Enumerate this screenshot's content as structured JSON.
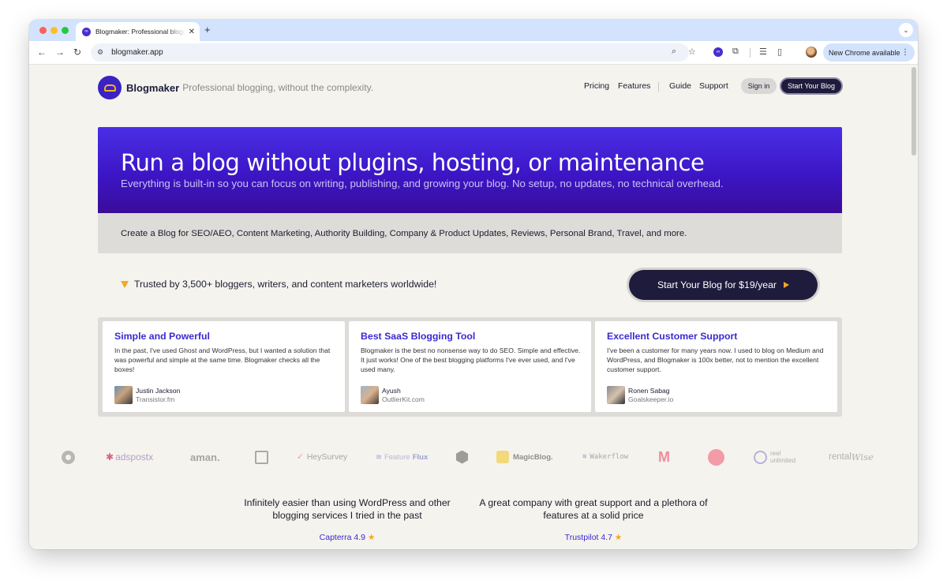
{
  "browser": {
    "tab_title": "Blogmaker: Professional blogging, without the complexity",
    "url": "blogmaker.app",
    "update_pill": "New Chrome available"
  },
  "site": {
    "brand_name": "Blogmaker",
    "tagline": "Professional blogging, without the complexity.",
    "nav": {
      "pricing": "Pricing",
      "features": "Features",
      "guide": "Guide",
      "support": "Support"
    },
    "signin": "Sign in",
    "start_small": "Start Your Blog"
  },
  "hero": {
    "title": "Run a blog without plugins, hosting, or maintenance",
    "subtitle": "Everything is built-in so you can focus on writing, publishing, and growing your blog. No setup, no updates, no technical overhead."
  },
  "usecases": "Create a Blog for SEO/AEO, Content Marketing, Authority Building, Company & Product Updates, Reviews, Personal Brand, Travel, and more.",
  "trusted": "Trusted by 3,500+ bloggers, writers, and content marketers worldwide!",
  "cta": "Start Your Blog for $19/year",
  "reviews": [
    {
      "title": "Simple and Powerful",
      "body": "In the past, I've used Ghost and WordPress, but I wanted a solution that was powerful and simple at the same time. Blogmaker checks all the boxes!",
      "name": "Justin Jackson",
      "site": "Transistor.fm"
    },
    {
      "title": "Best SaaS Blogging Tool",
      "body": "Blogmaker is the best no nonsense way to do SEO. Simple and effective. It just works! One of the best blogging platforms I've ever used, and I've used many.",
      "name": "Ayush",
      "site": "OutlierKit.com"
    },
    {
      "title": "Excellent Customer Support",
      "body": "I've been a customer for many years now. I used to blog on Medium and WordPress, and Blogmaker is 100x better, not to mention the excellent customer support.",
      "name": "Ronen Sabag",
      "site": "Goalskeeper.io"
    }
  ],
  "logos": {
    "adspostx": "adspostx",
    "aman": "aman.",
    "heysurvey": "HeySurvey",
    "featureflux_a": "Feature",
    "featureflux_b": "Flux",
    "magicblog": "MagicBlog.",
    "wakerflow": "Wakerflow",
    "reel_a": "reel",
    "reel_b": "unlimited",
    "rentalwise_a": "rental",
    "rentalwise_b": "Wise"
  },
  "testimonials": [
    {
      "quote": "Infinitely easier than using WordPress and other blogging services I tried in the past",
      "rating": "Capterra 4.9",
      "star": "★"
    },
    {
      "quote": "A great company with great support and a plethora of features at a solid price",
      "rating": "Trustpilot 4.7",
      "star": "★"
    }
  ]
}
